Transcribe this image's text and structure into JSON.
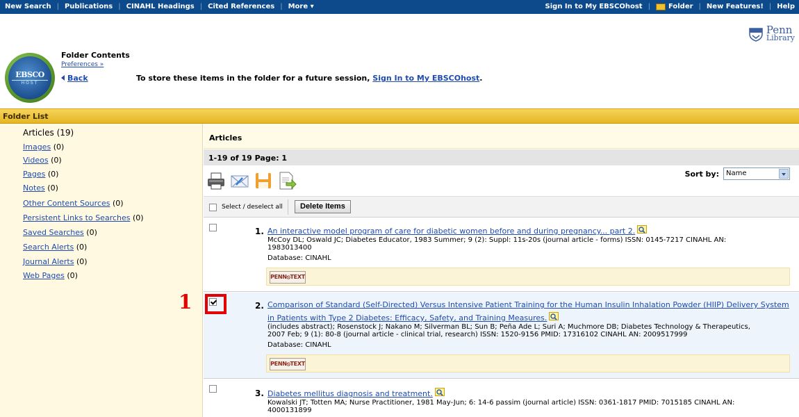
{
  "topnav": {
    "left_items": [
      "New Search",
      "Publications",
      "CINAHL Headings",
      "Cited References",
      "More ▾"
    ],
    "sign_in": "Sign In to My EBSCOhost",
    "folder": "Folder",
    "new_features": "New Features!",
    "help": "Help"
  },
  "header": {
    "logo_text": "EBSCO",
    "logo_subtext": "HOST",
    "folder_title": "Folder Contents",
    "preferences": "Preferences »",
    "back": "Back",
    "store_msg_prefix": "To store these items in the folder for a future session, ",
    "store_msg_link": "Sign In to My EBSCOhost",
    "store_msg_suffix": ".",
    "penn_line1": "Penn",
    "penn_line2": "Library"
  },
  "folder_list": {
    "label": "Folder List"
  },
  "sidebar": {
    "items": [
      {
        "label": "Articles",
        "count": "(19)",
        "active": true
      },
      {
        "label": "Images",
        "count": "(0)"
      },
      {
        "label": "Videos",
        "count": "(0)"
      },
      {
        "label": "Pages",
        "count": "(0)"
      },
      {
        "label": "Notes",
        "count": "(0)"
      },
      {
        "label": "Other Content Sources",
        "count": "(0)"
      },
      {
        "label": "Persistent Links to Searches",
        "count": "(0)"
      },
      {
        "label": "Saved Searches",
        "count": "(0)"
      },
      {
        "label": "Search Alerts",
        "count": "(0)"
      },
      {
        "label": "Journal Alerts",
        "count": "(0)"
      },
      {
        "label": "Web Pages",
        "count": "(0)"
      }
    ]
  },
  "main": {
    "heading": "Articles",
    "page_info": "1-19 of 19  Page: 1",
    "tools": [
      "print-icon",
      "email-icon",
      "save-icon",
      "export-icon"
    ],
    "sort_label": "Sort by:",
    "sort_value": "Name",
    "select_all": "Select / deselect all",
    "delete_button": "Delete Items",
    "results": [
      {
        "num": "1.",
        "checked": false,
        "title": "An interactive model program of care for diabetic women before and during pregnancy... part 2.",
        "meta_line1": "McCoy DL; Oswald JC; Diabetes Educator, 1983 Summer; 9 (2): Suppl: 11s-20s (journal article - forms) ISSN: 0145-7217 CINAHL AN:",
        "meta_line2": "1983013400",
        "database": "Database: CINAHL",
        "penntext": "PENN⦸TEXT"
      },
      {
        "num": "2.",
        "checked": true,
        "title_line1": "Comparison of Standard (Self-Directed) Versus Intensive Patient Training for the Human Insulin Inhalation Powder (HIIP) Delivery System",
        "title_line2": "in Patients with Type 2 Diabetes: Efficacy, Safety, and Training Measures.",
        "meta_line1": "(includes abstract); Rosenstock J; Nakano M; Silverman BL; Sun B; Peña Ade L; Suri A; Muchmore DB; Diabetes Technology & Therapeutics,",
        "meta_line2": "2007 Feb; 9 (1): 80-8 (journal article - clinical trial, research) ISSN: 1520-9156 PMID: 17316102 CINAHL AN: 2009517999",
        "database": "Database: CINAHL",
        "penntext": "PENN⦸TEXT"
      },
      {
        "num": "3.",
        "checked": false,
        "title": "Diabetes mellitus diagnosis and treatment.",
        "meta_line1": "Kowalski JT; Totten MA; Nurse Practitioner, 1981 May-Jun; 6: 14-6 passim (journal article) ISSN: 0361-1817 PMID: 7015185 CINAHL AN:",
        "meta_line2": "4000131899"
      }
    ]
  },
  "annotation": {
    "number": "1",
    "color": "#e30000"
  }
}
